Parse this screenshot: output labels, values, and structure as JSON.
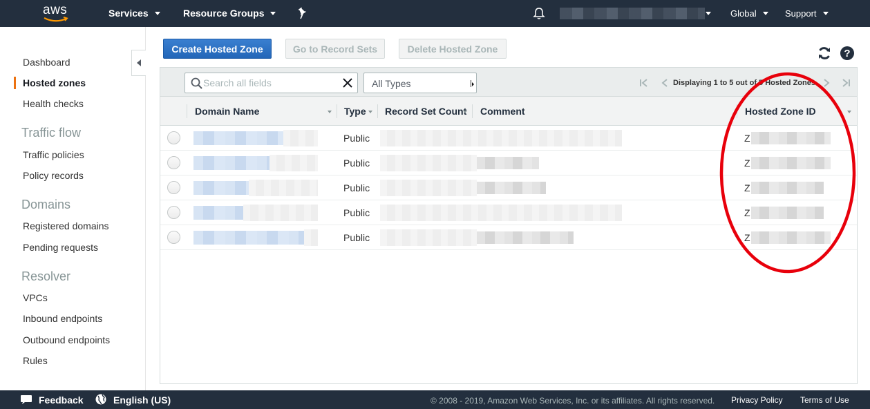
{
  "nav": {
    "logo": "aws",
    "services": "Services",
    "resource_groups": "Resource Groups",
    "pin_icon": "pin-icon",
    "bell_icon": "bell-icon",
    "region": "Global",
    "support": "Support"
  },
  "sidebar": {
    "items": [
      {
        "label": "Dashboard"
      },
      {
        "label": "Hosted zones",
        "active": true
      },
      {
        "label": "Health checks"
      }
    ],
    "traffic_flow": {
      "heading": "Traffic flow",
      "items": [
        "Traffic policies",
        "Policy records"
      ]
    },
    "domains": {
      "heading": "Domains",
      "items": [
        "Registered domains",
        "Pending requests"
      ]
    },
    "resolver": {
      "heading": "Resolver",
      "items": [
        "VPCs",
        "Inbound endpoints",
        "Outbound endpoints",
        "Rules"
      ]
    }
  },
  "actions": {
    "create": "Create Hosted Zone",
    "go_to_records": "Go to Record Sets",
    "delete": "Delete Hosted Zone"
  },
  "toolbar": {
    "search_placeholder": "Search all fields",
    "type_select": "All Types",
    "pager_text": "Displaying 1 to 5 out of 5 Hosted Zones"
  },
  "table": {
    "columns": [
      "Domain Name",
      "Type",
      "Record Set Count",
      "Comment",
      "Hosted Zone ID"
    ],
    "rows": [
      {
        "type": "Public",
        "zone_prefix": "Z"
      },
      {
        "type": "Public",
        "zone_prefix": "Z"
      },
      {
        "type": "Public",
        "zone_prefix": "Z"
      },
      {
        "type": "Public",
        "zone_prefix": "Z"
      },
      {
        "type": "Public",
        "zone_prefix": "Z"
      }
    ]
  },
  "annotation": {
    "color": "#e8000b"
  },
  "footer": {
    "feedback": "Feedback",
    "language": "English (US)",
    "copyright": "© 2008 - 2019, Amazon Web Services, Inc. or its affiliates. All rights reserved.",
    "privacy": "Privacy Policy",
    "terms": "Terms of Use"
  },
  "colors": {
    "nav_bg": "#232f3e",
    "primary": "#2e6fbf",
    "active": "#ec7211"
  }
}
